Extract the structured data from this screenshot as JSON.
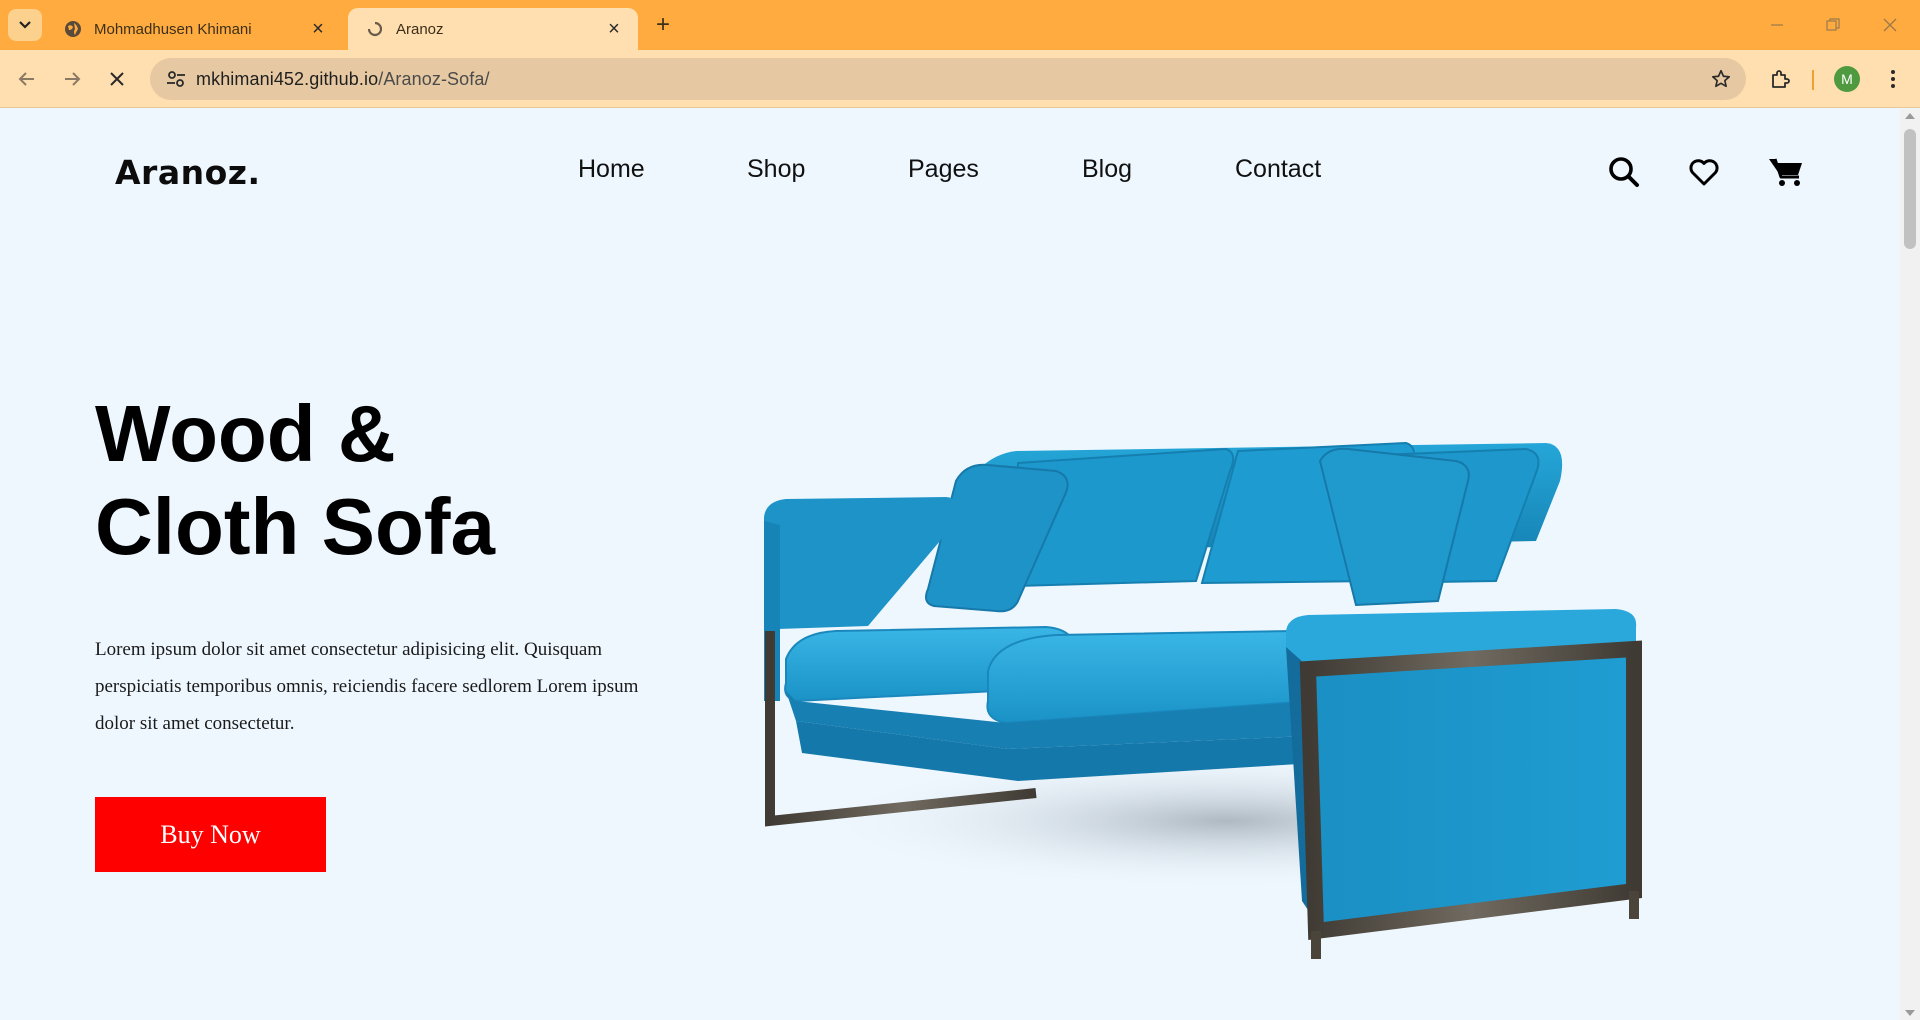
{
  "browser": {
    "tabs": [
      {
        "title": "Mohmadhusen Khimani",
        "active": false,
        "favicon": "globe-icon"
      },
      {
        "title": "Aranoz",
        "active": true,
        "favicon": "loading-spinner-icon"
      }
    ],
    "url_domain": "mkhimani452.github.io",
    "url_path": "/Aranoz-Sofa/",
    "profile_initial": "M",
    "colors": {
      "tabbar": "#ffab40",
      "toolbar": "#ffdfb0",
      "omnibox": "#e6c9a2",
      "avatar": "#4f9a3f"
    }
  },
  "site": {
    "logo": "Aranoz.",
    "nav": [
      "Home",
      "Shop",
      "Pages",
      "Blog",
      "Contact"
    ],
    "header_icons": [
      "search-icon",
      "heart-icon",
      "cart-icon"
    ]
  },
  "hero": {
    "title_line1": "Wood &",
    "title_line2": "Cloth Sofa",
    "description": "Lorem ipsum dolor sit amet consectetur adipisicing elit. Quisquam perspiciatis temporibus omnis, reiciendis facere sedlorem Lorem ipsum dolor sit amet consectetur.",
    "cta_label": "Buy Now",
    "colors": {
      "cta": "#ff0000",
      "background": "#eef7fe",
      "sofa": "#1e9fd4"
    }
  }
}
